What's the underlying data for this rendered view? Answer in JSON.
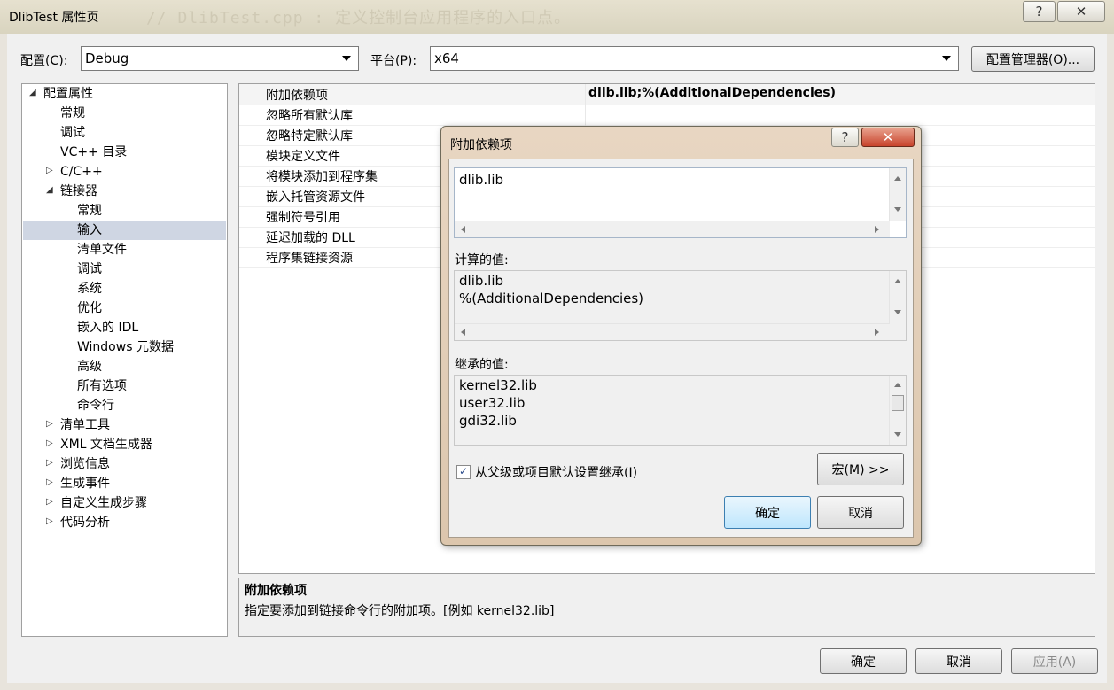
{
  "window": {
    "title": "DlibTest 属性页",
    "background_text": "// DlibTest.cpp : 定义控制台应用程序的入口点。",
    "help_label": "?",
    "close_label": "✕"
  },
  "toolbar": {
    "config_label": "配置(C):",
    "config_value": "Debug",
    "platform_label": "平台(P):",
    "platform_value": "x64",
    "config_manager_label": "配置管理器(O)..."
  },
  "tree": {
    "items": [
      {
        "label": "配置属性",
        "expander": "◢"
      },
      {
        "label": "常规",
        "expander": ""
      },
      {
        "label": "调试",
        "expander": ""
      },
      {
        "label": "VC++ 目录",
        "expander": ""
      },
      {
        "label": "C/C++",
        "expander": "▷"
      },
      {
        "label": "链接器",
        "expander": "◢"
      },
      {
        "label": "常规",
        "expander": ""
      },
      {
        "label": "输入",
        "expander": ""
      },
      {
        "label": "清单文件",
        "expander": ""
      },
      {
        "label": "调试",
        "expander": ""
      },
      {
        "label": "系统",
        "expander": ""
      },
      {
        "label": "优化",
        "expander": ""
      },
      {
        "label": "嵌入的 IDL",
        "expander": ""
      },
      {
        "label": "Windows 元数据",
        "expander": ""
      },
      {
        "label": "高级",
        "expander": ""
      },
      {
        "label": "所有选项",
        "expander": ""
      },
      {
        "label": "命令行",
        "expander": ""
      },
      {
        "label": "清单工具",
        "expander": "▷"
      },
      {
        "label": "XML 文档生成器",
        "expander": "▷"
      },
      {
        "label": "浏览信息",
        "expander": "▷"
      },
      {
        "label": "生成事件",
        "expander": "▷"
      },
      {
        "label": "自定义生成步骤",
        "expander": "▷"
      },
      {
        "label": "代码分析",
        "expander": "▷"
      }
    ]
  },
  "grid": {
    "rows": [
      {
        "name": "附加依赖项",
        "value": "dlib.lib;%(AdditionalDependencies)"
      },
      {
        "name": "忽略所有默认库",
        "value": ""
      },
      {
        "name": "忽略特定默认库",
        "value": ""
      },
      {
        "name": "模块定义文件",
        "value": ""
      },
      {
        "name": "将模块添加到程序集",
        "value": ""
      },
      {
        "name": "嵌入托管资源文件",
        "value": ""
      },
      {
        "name": "强制符号引用",
        "value": ""
      },
      {
        "name": "延迟加载的 DLL",
        "value": ""
      },
      {
        "name": "程序集链接资源",
        "value": ""
      }
    ]
  },
  "description": {
    "title": "附加依赖项",
    "text": "指定要添加到链接命令行的附加项。[例如 kernel32.lib]"
  },
  "buttons": {
    "ok": "确定",
    "cancel": "取消",
    "apply": "应用(A)"
  },
  "dialog": {
    "title": "附加依赖项",
    "help_label": "?",
    "close_label": "✕",
    "input_value": "dlib.lib",
    "computed_label": "计算的值:",
    "computed_lines": [
      "dlib.lib",
      "%(AdditionalDependencies)"
    ],
    "inherited_label": "继承的值:",
    "inherited_lines": [
      "kernel32.lib",
      "user32.lib",
      "gdi32.lib"
    ],
    "inherit_checkbox_label": "从父级或项目默认设置继承(I)",
    "inherit_checked": true,
    "macro_button": "宏(M) >>",
    "ok": "确定",
    "cancel": "取消"
  }
}
